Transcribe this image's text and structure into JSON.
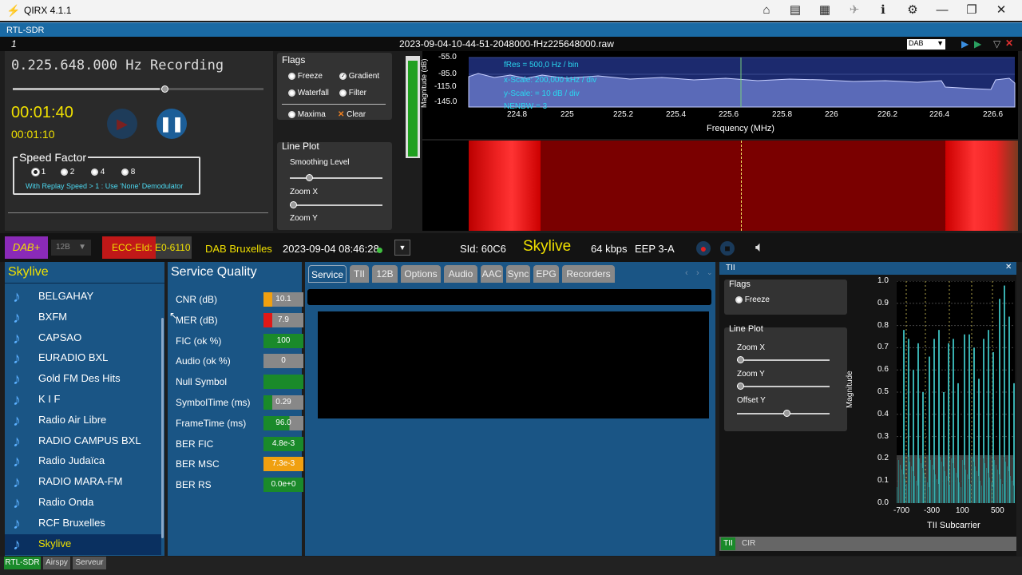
{
  "app": {
    "title": "QIRX 4.1.1"
  },
  "rtl_bar": {
    "label": "RTL-SDR"
  },
  "filebar": {
    "index": "1",
    "filename": "2023-09-04-10-44-51-2048000-fHz225648000.raw",
    "mode": "DAB"
  },
  "playback": {
    "freq": "0.225.648.000 Hz Recording",
    "time_main": "00:01:40",
    "time_sub": "00:01:10"
  },
  "speed": {
    "title": "Speed Factor",
    "options": [
      "1",
      "2",
      "4",
      "8"
    ],
    "note": "With Replay Speed > 1 : Use 'None' Demodulator"
  },
  "flags": {
    "title": "Flags",
    "freeze": "Freeze",
    "gradient": "Gradient",
    "waterfall": "Waterfall",
    "filter": "Filter",
    "maxima": "Maxima",
    "clear": "Clear"
  },
  "lineplot": {
    "title": "Line Plot",
    "smoothing": "Smoothing Level",
    "zoomx": "Zoom X",
    "zoomy": "Zoom Y"
  },
  "spectrum": {
    "ylabel": "Magnitude (dB)",
    "yticks": [
      "-55.0",
      "-85.0",
      "-115.0",
      "-145.0"
    ],
    "xticks": [
      "224.8",
      "225",
      "225.2",
      "225.4",
      "225.6",
      "225.8",
      "226",
      "226.2",
      "226.4",
      "226.6"
    ],
    "xlabel": "Frequency (MHz)",
    "info": [
      "fRes = 500,0 Hz / bin",
      "x-Scale: 200,000 kHz / div",
      "y-Scale: = 10 dB / div",
      "NENBW = 3"
    ]
  },
  "status": {
    "dab": "DAB+",
    "channel": "12B",
    "ecc": "ECC-EId: E0-6110",
    "ensemble": "DAB Bruxelles",
    "datetime": "2023-09-04  08:46:28",
    "sid": "SId: 60C6",
    "service": "Skylive",
    "rate": "64 kbps",
    "eep": "EEP 3-A"
  },
  "services": {
    "title": "Skylive",
    "items": [
      "BELGAHAY",
      "BXFM",
      "CAPSAO",
      "EURADIO BXL",
      "Gold FM Des Hits",
      "K I F",
      "Radio Air Libre",
      "RADIO CAMPUS BXL",
      "Radio Judaïca",
      "RADIO MARA-FM",
      "Radio Onda",
      "RCF Bruxelles",
      "Skylive"
    ],
    "selected": "Skylive"
  },
  "quality": {
    "title": "Service Quality",
    "rows": [
      {
        "label": "CNR (dB)",
        "value": "10.1"
      },
      {
        "label": "MER (dB)",
        "value": "7.9"
      },
      {
        "label": "FIC (ok %)",
        "value": "100"
      },
      {
        "label": "Audio (ok %)",
        "value": "0"
      },
      {
        "label": "Null Symbol",
        "value": ""
      },
      {
        "label": "SymbolTime (ms)",
        "value": "0.29"
      },
      {
        "label": "FrameTime (ms)",
        "value": "96.0"
      },
      {
        "label": "BER FIC",
        "value": "4.8e-3"
      },
      {
        "label": "BER MSC",
        "value": "7.3e-3"
      },
      {
        "label": "BER RS",
        "value": "0.0e+0"
      }
    ]
  },
  "tabs": [
    "Service",
    "TII",
    "12B",
    "Options",
    "Audio",
    "AAC",
    "Sync",
    "EPG",
    "Recorders"
  ],
  "tii": {
    "title": "TII",
    "flags": "Flags",
    "freeze": "Freeze",
    "lineplot": "Line Plot",
    "zoomx": "Zoom X",
    "zoomy": "Zoom Y",
    "offsety": "Offset Y",
    "ylabel": "Magnitude",
    "xlabel": "TII Subcarrier",
    "yticks": [
      "1.0",
      "0.9",
      "0.8",
      "0.7",
      "0.6",
      "0.5",
      "0.4",
      "0.3",
      "0.2",
      "0.1",
      "0.0"
    ],
    "xticks": [
      "-700",
      "-300",
      "100",
      "500"
    ],
    "tab1": "TII",
    "tab2": "CIR"
  },
  "bottom_tabs": [
    "RTL-SDR",
    "Airspy",
    "Serveur"
  ]
}
